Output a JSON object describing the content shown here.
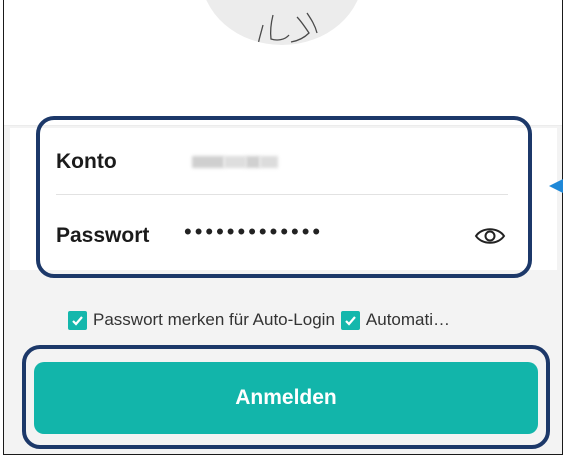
{
  "login_form": {
    "account": {
      "label": "Konto"
    },
    "password": {
      "label": "Passwort",
      "masked_value": "•••••••••••••"
    }
  },
  "options": {
    "remember_password": {
      "label": "Passwort merken für Auto-Login",
      "checked": true
    },
    "auto": {
      "label": "Automati…",
      "checked": true
    }
  },
  "login_button": {
    "label": "Anmelden"
  },
  "colors": {
    "accent": "#12b5aa",
    "highlight_border": "#1c3869",
    "pointer_arrow": "#1e88d8"
  },
  "icons": {
    "password_visibility": "eye-icon",
    "checkbox": "checkmark-icon"
  }
}
